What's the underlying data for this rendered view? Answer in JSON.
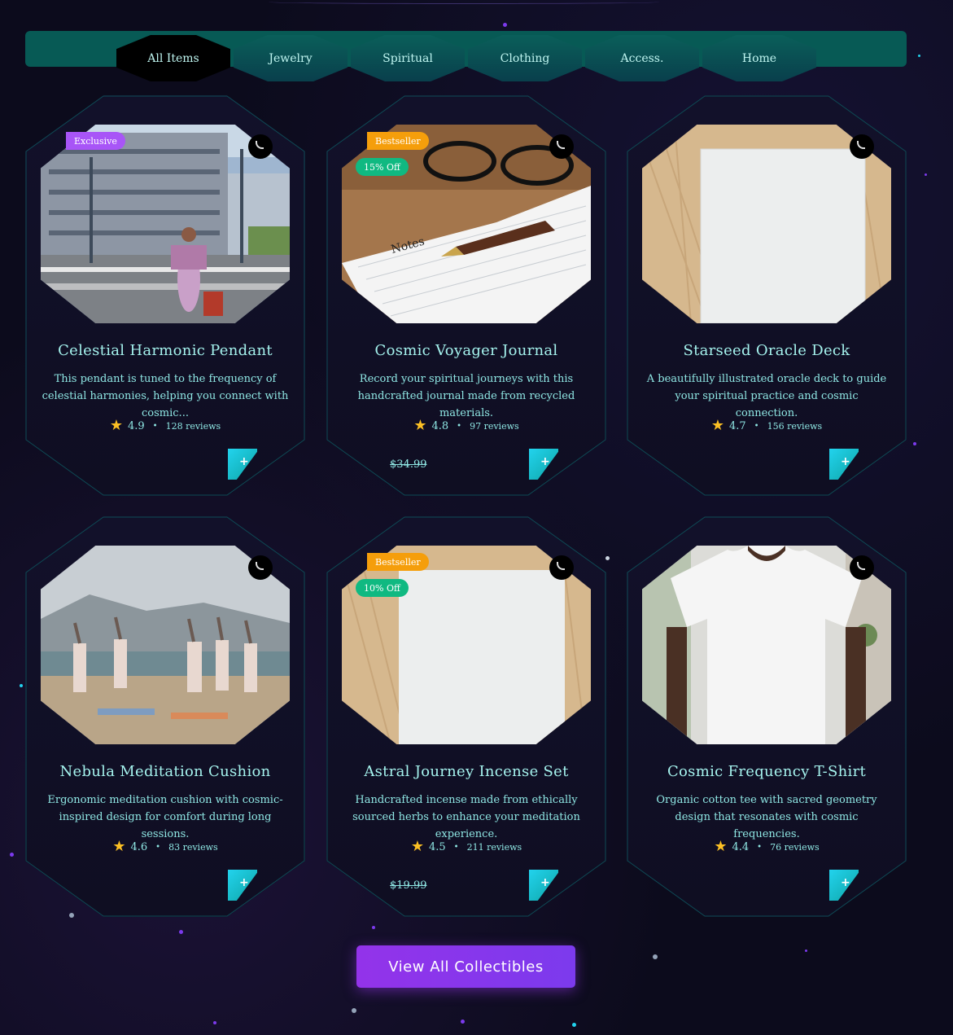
{
  "filters": {
    "tabs": [
      {
        "label": "All Items",
        "active": true
      },
      {
        "label": "Jewelry",
        "active": false
      },
      {
        "label": "Spiritual",
        "active": false
      },
      {
        "label": "Clothing",
        "active": false
      },
      {
        "label": "Access.",
        "active": false
      },
      {
        "label": "Home",
        "active": false
      }
    ]
  },
  "products": [
    {
      "title": "Celestial Harmonic Pendant",
      "description": "This pendant is tuned to the frequency of celestial harmonies, helping you connect with cosmic...",
      "rating": "4.9",
      "reviews": "128 reviews",
      "badges": [
        "Exclusive"
      ],
      "old_price": "",
      "image": "street-scene"
    },
    {
      "title": "Cosmic Voyager Journal",
      "description": "Record your spiritual journeys with this handcrafted journal made from recycled materials.",
      "rating": "4.8",
      "reviews": "97 reviews",
      "badges": [
        "Bestseller",
        "15% Off"
      ],
      "old_price": "$34.99",
      "image": "notebook-pen"
    },
    {
      "title": "Starseed Oracle Deck",
      "description": "A beautifully illustrated oracle deck to guide your spiritual practice and cosmic connection.",
      "rating": "4.7",
      "reviews": "156 reviews",
      "badges": [],
      "old_price": "",
      "image": "paper-on-wood"
    },
    {
      "title": "Nebula Meditation Cushion",
      "description": "Ergonomic meditation cushion with cosmic-inspired design for comfort during long sessions.",
      "rating": "4.6",
      "reviews": "83 reviews",
      "badges": [],
      "old_price": "",
      "image": "beach-yoga"
    },
    {
      "title": "Astral Journey Incense Set",
      "description": "Handcrafted incense made from ethically sourced herbs to enhance your meditation experience.",
      "rating": "4.5",
      "reviews": "211 reviews",
      "badges": [
        "Bestseller",
        "10% Off"
      ],
      "old_price": "$19.99",
      "image": "paper-on-wood"
    },
    {
      "title": "Cosmic Frequency T-Shirt",
      "description": "Organic cotton tee with sacred geometry design that resonates with cosmic frequencies.",
      "rating": "4.4",
      "reviews": "76 reviews",
      "badges": [],
      "old_price": "",
      "image": "white-tshirt"
    }
  ],
  "icons": {
    "rating": "star-icon",
    "wishlist": "heart-icon",
    "add": "cart-icon"
  },
  "colors": {
    "accent_teal": "#075a55",
    "accent_purple": "#9333ea",
    "star": "#fbbf24",
    "badge_exclusive": "#a855f7",
    "badge_bestseller": "#f59e0b",
    "badge_discount": "#10b981"
  },
  "cta": {
    "label": "View All Collectibles"
  }
}
